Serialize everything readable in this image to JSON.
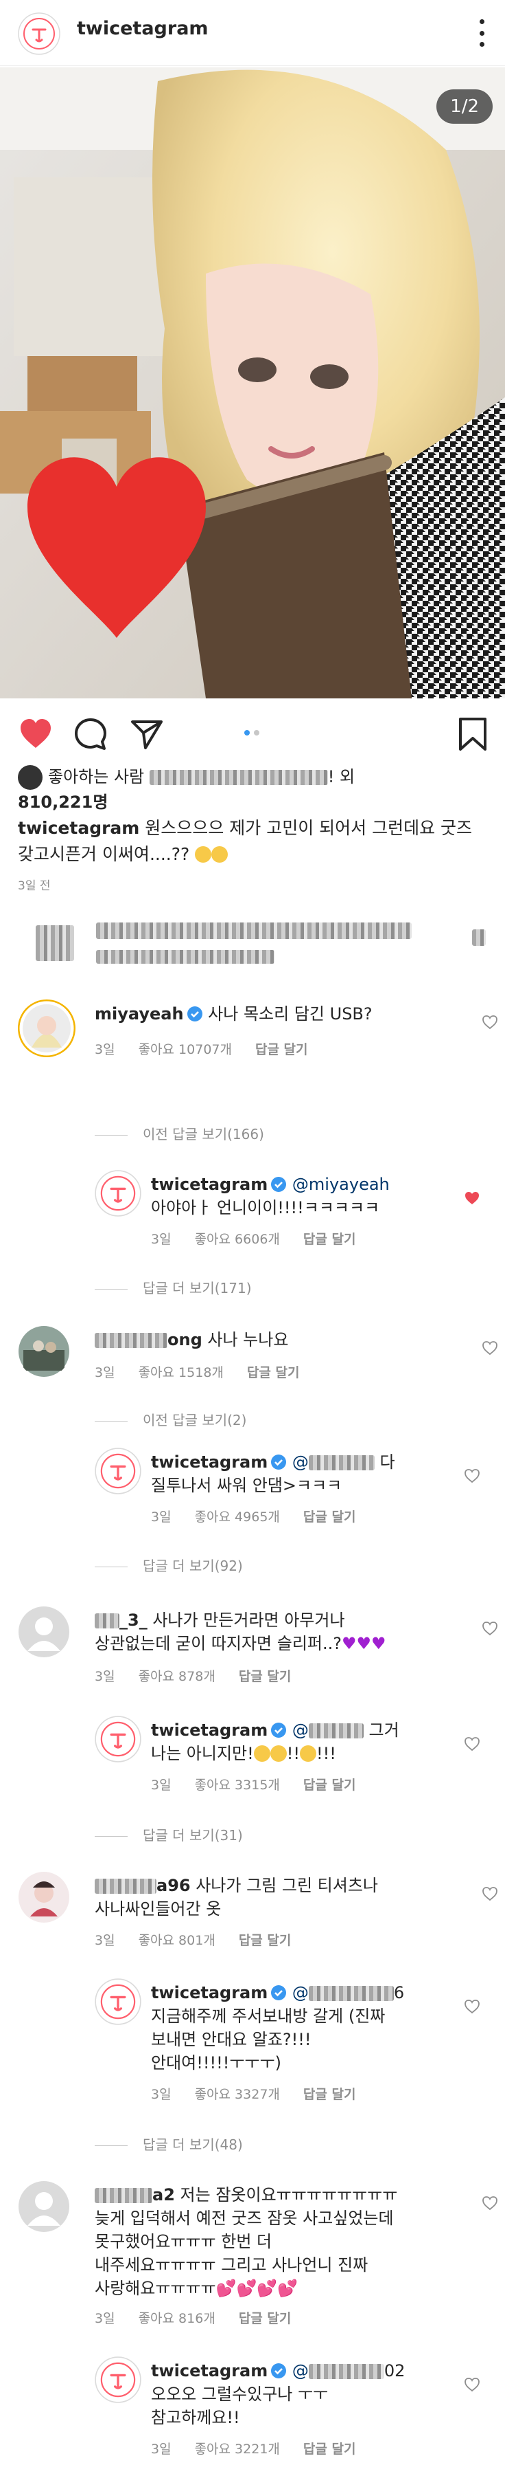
{
  "header": {
    "username": "twicetagram"
  },
  "photo": {
    "counter": "1/2"
  },
  "pager": {
    "total": 2,
    "current": 1
  },
  "likes": {
    "prefix": "좋아하는 사람",
    "suffix": "! 외",
    "count": "810,221명"
  },
  "caption": {
    "username": "twicetagram",
    "text": " 원스으으으 제가 고민이 되어서 그런데요 굿즈 갖고시픈거 이써여....??",
    "time": "3일 전"
  },
  "comments": [
    {
      "username": "miyayeah",
      "verified": true,
      "text": " 사나 목소리 담긴 USB?",
      "time": "3일",
      "likes": "좋아요 10707개",
      "reply": "답글 달기",
      "view_replies": "이전 답글 보기(166)"
    },
    {
      "username": "twicetagram",
      "mention": "@miyayeah",
      "text": "아야아ㅏ 언니이이!!!!ㅋㅋㅋㅋㅋ",
      "time": "3일",
      "likes": "좋아요 6606개",
      "reply": "답글 달기",
      "more_replies": "답글 더 보기(171)"
    },
    {
      "username_tail": "ong",
      "text": " 사나 누나요",
      "time": "3일",
      "likes": "좋아요 1518개",
      "reply": "답글 달기",
      "view_replies": "이전 답글 보기(2)"
    },
    {
      "username": "twicetagram",
      "mention": "@",
      "text_tail": " 다",
      "text2": "질투나서 싸워 안댐>ㅋㅋㅋ",
      "time": "3일",
      "likes": "좋아요 4965개",
      "reply": "답글 달기",
      "more_replies": "답글 더 보기(92)"
    },
    {
      "username_tail": "_3_",
      "text": " 사나가 만든거라면 아무거나",
      "text2": "상관없는데 굳이 따지자면 슬리퍼..?",
      "time": "3일",
      "likes": "좋아요 878개",
      "reply": "답글 달기"
    },
    {
      "username": "twicetagram",
      "mention": "@",
      "text_tail": " 그거",
      "text2": "나는 아니지만!",
      "text2b": "!!",
      "text2c": "!!!",
      "time": "3일",
      "likes": "좋아요 3315개",
      "reply": "답글 달기",
      "more_replies": "답글 더 보기(31)"
    },
    {
      "username_tail": "a96",
      "text": " 사나가 그림 그린 티셔츠나",
      "text2": "사나싸인들어간 옷",
      "time": "3일",
      "likes": "좋아요 801개",
      "reply": "답글 달기"
    },
    {
      "username": "twicetagram",
      "mention": "@",
      "text_tail": "6",
      "text2": "지금해주께 주서보내방 갈게 (진짜",
      "text3": "보내면 안대요 알죠?!!!",
      "text4": "안대여!!!!!ㅜㅜㅜ)",
      "time": "3일",
      "likes": "좋아요 3327개",
      "reply": "답글 달기",
      "more_replies": "답글 더 보기(48)"
    },
    {
      "username_tail": "a2",
      "text": " 저는 잠옷이요ㅠㅠㅠㅠㅠㅠㅠㅠ",
      "text2": "늦게 입덕해서 예전 굿즈 잠옷 사고싶었는데",
      "text3": "못구했어요ㅠㅠㅠ 한번 더",
      "text4": "내주세요ㅠㅠㅠㅠ 그리고 사나언니 진짜",
      "text5": "사랑해요ㅠㅠㅠㅠ",
      "time": "3일",
      "likes": "좋아요 816개",
      "reply": "답글 달기"
    },
    {
      "username": "twicetagram",
      "mention": "@",
      "text_tail": "02",
      "text2": "오오오 그럴수있구나 ㅜㅜ",
      "text3": "참고하께요!!",
      "time": "3일",
      "likes": "좋아요 3221개",
      "reply": "답글 달기"
    }
  ],
  "colors": {
    "like_red": "#ed4956",
    "verified_blue": "#3897f0",
    "muted": "#8e8e8e"
  }
}
